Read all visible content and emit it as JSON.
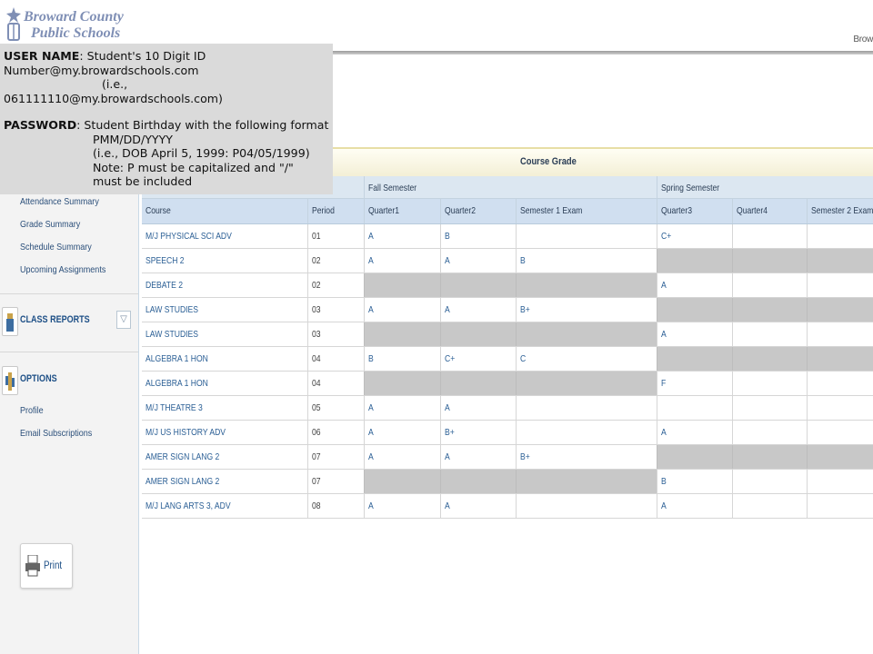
{
  "header": {
    "logo_line1": "Broward County",
    "logo_line2": "Public Schools",
    "top_right_text": "Brow"
  },
  "login_note": {
    "username_label": "USER NAME",
    "username_text": ": Student's 10 Digit ID",
    "username_line2": "Number@my.browardschools.com",
    "username_line3": "(i.e.,",
    "username_line4": "061111110@my.browardschools.com)",
    "password_label": "PASSWORD",
    "password_text": ":   Student Birthday with the following format",
    "password_line2": "PMM/DD/YYYY",
    "password_line3": "(i.e., DOB April 5, 1999:  P04/05/1999)",
    "password_line4": "Note: P must be capitalized and \"/\"",
    "password_line5": "must be included"
  },
  "sidebar": {
    "links": [
      "Attendance Summary",
      "Grade Summary",
      "Schedule Summary",
      "Upcoming Assignments"
    ],
    "class_reports_title": "CLASS REPORTS",
    "options_title": "OPTIONS",
    "options_links": [
      "Profile",
      "Email Subscriptions"
    ],
    "print_label": "Print"
  },
  "table": {
    "course_grade_title": "Course Grade",
    "fall_semester": "Fall Semester",
    "spring_semester": "Spring Semester",
    "columns": [
      "Course",
      "Period",
      "Quarter1",
      "Quarter2",
      "Semester 1 Exam",
      "Quarter3",
      "Quarter4",
      "Semester 2 Exam"
    ],
    "rows": [
      {
        "course": "M/J PHYSICAL SCI ADV",
        "period": "01",
        "q1": "A",
        "q2": "B",
        "s1": "",
        "q3": "C+",
        "q4": "",
        "s2": "",
        "fall_shaded": false,
        "spring_shaded": false
      },
      {
        "course": "SPEECH 2",
        "period": "02",
        "q1": "A",
        "q2": "A",
        "s1": "B",
        "q3": "",
        "q4": "",
        "s2": "",
        "fall_shaded": false,
        "spring_shaded": true
      },
      {
        "course": "DEBATE 2",
        "period": "02",
        "q1": "",
        "q2": "",
        "s1": "",
        "q3": "A",
        "q4": "",
        "s2": "",
        "fall_shaded": true,
        "spring_shaded": false
      },
      {
        "course": "LAW STUDIES",
        "period": "03",
        "q1": "A",
        "q2": "A",
        "s1": "B+",
        "q3": "",
        "q4": "",
        "s2": "",
        "fall_shaded": false,
        "spring_shaded": true
      },
      {
        "course": "LAW STUDIES",
        "period": "03",
        "q1": "",
        "q2": "",
        "s1": "",
        "q3": "A",
        "q4": "",
        "s2": "",
        "fall_shaded": true,
        "spring_shaded": false
      },
      {
        "course": "ALGEBRA 1 HON",
        "period": "04",
        "q1": "B",
        "q2": "C+",
        "s1": "C",
        "q3": "",
        "q4": "",
        "s2": "",
        "fall_shaded": false,
        "spring_shaded": true
      },
      {
        "course": "ALGEBRA 1 HON",
        "period": "04",
        "q1": "",
        "q2": "",
        "s1": "",
        "q3": "F",
        "q4": "",
        "s2": "",
        "fall_shaded": true,
        "spring_shaded": false
      },
      {
        "course": "M/J THEATRE 3",
        "period": "05",
        "q1": "A",
        "q2": "A",
        "s1": "",
        "q3": "",
        "q4": "",
        "s2": "",
        "fall_shaded": false,
        "spring_shaded": false
      },
      {
        "course": "M/J US HISTORY ADV",
        "period": "06",
        "q1": "A",
        "q2": "B+",
        "s1": "",
        "q3": "A",
        "q4": "",
        "s2": "",
        "fall_shaded": false,
        "spring_shaded": false
      },
      {
        "course": "AMER SIGN LANG 2",
        "period": "07",
        "q1": "A",
        "q2": "A",
        "s1": "B+",
        "q3": "",
        "q4": "",
        "s2": "",
        "fall_shaded": false,
        "spring_shaded": true
      },
      {
        "course": "AMER SIGN LANG 2",
        "period": "07",
        "q1": "",
        "q2": "",
        "s1": "",
        "q3": "B",
        "q4": "",
        "s2": "",
        "fall_shaded": true,
        "spring_shaded": false
      },
      {
        "course": "M/J LANG ARTS 3, ADV",
        "period": "08",
        "q1": "A",
        "q2": "A",
        "s1": "",
        "q3": "A",
        "q4": "",
        "s2": "",
        "fall_shaded": false,
        "spring_shaded": false
      }
    ]
  }
}
